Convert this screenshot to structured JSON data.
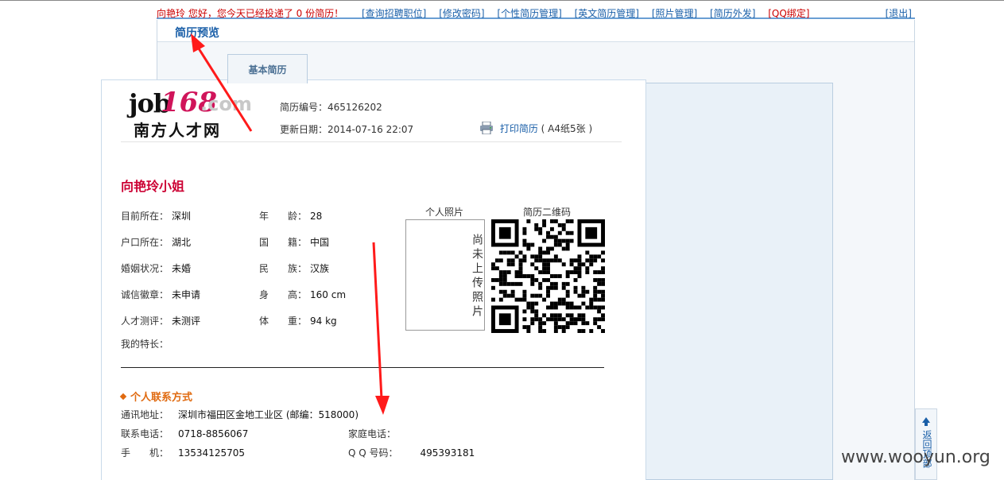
{
  "header": {
    "welcome": "向艳玲 您好，您今天已经投递了 0 份简历！",
    "nav": [
      "[查询招聘职位]",
      "[修改密码]",
      "[个性简历管理]",
      "[英文简历管理]",
      "[照片管理]",
      "[简历外发]"
    ],
    "qq": "[QQ绑定]",
    "logout": "[退出]"
  },
  "preview_title": "简历预览",
  "tab_label": "基本简历",
  "logo": {
    "job": "job",
    "num": "168",
    "com": ".com",
    "cn": "南方人才网"
  },
  "resume_meta": {
    "id_label": "简历编号：",
    "id": "465126202",
    "date_label": "更新日期：",
    "date": "2014-07-16 22:07",
    "print_label": "打印简历",
    "print_note": "( A4纸5张 )"
  },
  "name": "向艳玲小姐",
  "fields_left": [
    {
      "label": "目前所在：",
      "value": "深圳"
    },
    {
      "label": "户口所在：",
      "value": "湖北"
    },
    {
      "label": "婚姻状况：",
      "value": "未婚"
    },
    {
      "label": "诚信徽章：",
      "value": "未申请"
    },
    {
      "label": "人才测评：",
      "value": "未测评"
    },
    {
      "label": "我的特长：",
      "value": ""
    }
  ],
  "fields_right": [
    {
      "label": "年　　龄：",
      "value": "28"
    },
    {
      "label": "国　　籍：",
      "value": "中国"
    },
    {
      "label": "民　　族：",
      "value": "汉族"
    },
    {
      "label": "身　　高：",
      "value": "160 cm"
    },
    {
      "label": "体　　重：",
      "value": "94 kg"
    }
  ],
  "photo": {
    "label": "个人照片",
    "placeholder": "尚未上传照片"
  },
  "qr_label": "简历二维码",
  "contact": {
    "title": "个人联系方式",
    "address_label": "通讯地址：",
    "address": "深圳市福田区金地工业区 (邮编：518000)",
    "phone_label": "联系电话：",
    "phone": "0718-8856067",
    "home_label": "家庭电话：",
    "home": "",
    "mobile_label": "手　　机：",
    "mobile": "13534125705",
    "qq_label": "Q Q 号码：",
    "qq": "495393181"
  },
  "back_top": "返回顶部",
  "watermark": "www.wooyun.org",
  "colors": {
    "link": "#1a5fa8",
    "alert": "#cc0000",
    "name": "#cc0033",
    "section": "#e06a10",
    "arrow": "#ff1a1a"
  }
}
